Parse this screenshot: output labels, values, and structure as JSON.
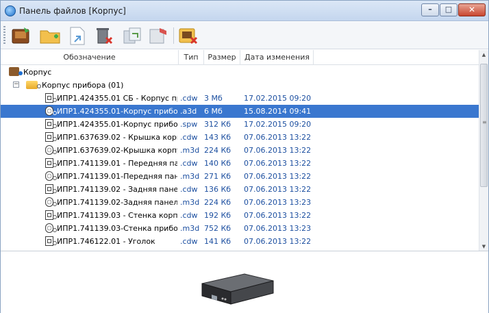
{
  "window": {
    "title": "Панель файлов [Корпус]",
    "buttons": {
      "minimize": "–",
      "maximize": "□",
      "close": "✕"
    }
  },
  "toolbar": {
    "icons": [
      "open-file-icon",
      "new-folder-icon",
      "export-icon",
      "delete-icon",
      "copy-icon",
      "properties-icon",
      "close-panel-icon"
    ]
  },
  "list": {
    "columns": {
      "name": "Обозначение",
      "type": "Тип",
      "size": "Размер",
      "date": "Дата изменения"
    },
    "root": {
      "label": "Корпус"
    },
    "folder": {
      "label": "Корпус прибора (01)"
    },
    "rows": [
      {
        "name": "ИПР1.424355.01 СБ - Корпус пр",
        "type": ".cdw",
        "size": "3 Мб",
        "date": "17.02.2015 09:20",
        "selected": false
      },
      {
        "name": "ИПР1.424355.01-Корпус прибо",
        "type": ".a3d",
        "size": "6 Мб",
        "date": "15.08.2014 09:41",
        "selected": true
      },
      {
        "name": "ИПР1.424355.01-Корпус прибо",
        "type": ".spw",
        "size": "312 Кб",
        "date": "17.02.2015 09:20",
        "selected": false
      },
      {
        "name": "ИПР1.637639.02 - Крышка корп",
        "type": ".cdw",
        "size": "143 Кб",
        "date": "07.06.2013 13:22",
        "selected": false
      },
      {
        "name": "ИПР1.637639.02-Крышка корпу",
        "type": ".m3d",
        "size": "224 Кб",
        "date": "07.06.2013 13:22",
        "selected": false
      },
      {
        "name": "ИПР1.741139.01 - Передняя па",
        "type": ".cdw",
        "size": "140 Кб",
        "date": "07.06.2013 13:22",
        "selected": false
      },
      {
        "name": "ИПР1.741139.01-Передняя пан",
        "type": ".m3d",
        "size": "271 Кб",
        "date": "07.06.2013 13:22",
        "selected": false
      },
      {
        "name": "ИПР1.741139.02 - Задняя панел",
        "type": ".cdw",
        "size": "136 Кб",
        "date": "07.06.2013 13:22",
        "selected": false
      },
      {
        "name": "ИПР1.741139.02-Задняя панель",
        "type": ".m3d",
        "size": "224 Кб",
        "date": "07.06.2013 13:23",
        "selected": false
      },
      {
        "name": "ИПР1.741139.03 - Стенка корпу",
        "type": ".cdw",
        "size": "192 Кб",
        "date": "07.06.2013 13:22",
        "selected": false
      },
      {
        "name": "ИПР1.741139.03-Стенка прибор",
        "type": ".m3d",
        "size": "752 Кб",
        "date": "07.06.2013 13:23",
        "selected": false
      },
      {
        "name": "ИПР1.746122.01 - Уголок",
        "type": ".cdw",
        "size": "141 Кб",
        "date": "07.06.2013 13:22",
        "selected": false
      }
    ]
  },
  "colors": {
    "selection": "#3a77cf",
    "link": "#1c4fa0",
    "titlebar": "#c4d6ee"
  }
}
